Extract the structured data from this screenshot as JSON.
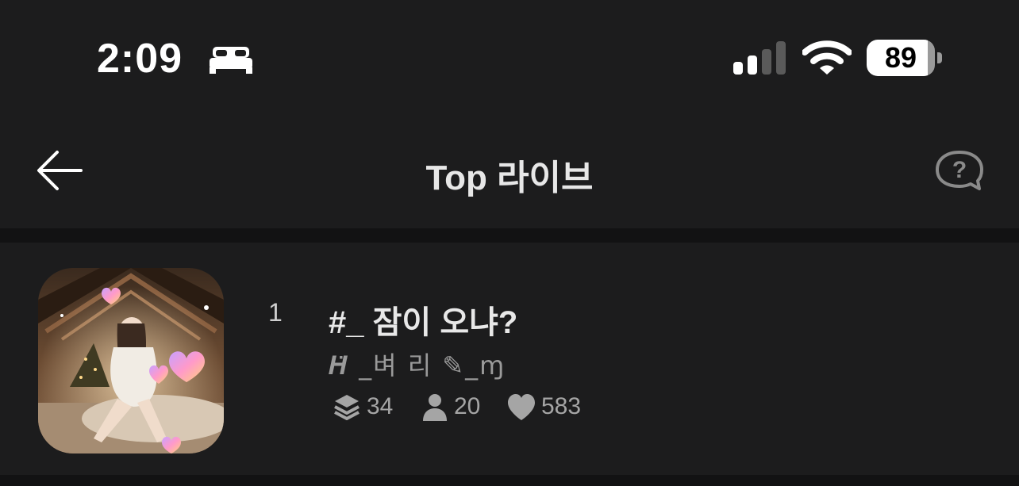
{
  "status_bar": {
    "time": "2:09",
    "focus_icon": "bed-icon",
    "signal_icon": "cellular-signal-icon",
    "wifi_icon": "wifi-icon",
    "battery": {
      "level": 89,
      "label": "89"
    }
  },
  "nav": {
    "back_icon": "arrow-left-icon",
    "title": "Top 라이브",
    "help_icon": "question-bubble-icon"
  },
  "list": [
    {
      "rank": "1",
      "title": "#_ 잠이 오냐?",
      "author": "𝑯̈ _벼 리 ✎_ɱ",
      "stats": {
        "layers": "34",
        "people": "20",
        "likes": "583"
      }
    }
  ],
  "colors": {
    "background": "#1c1c1d",
    "divider": "#121213",
    "title_text": "#e7e7e7",
    "secondary_text": "#9a9a9a"
  }
}
